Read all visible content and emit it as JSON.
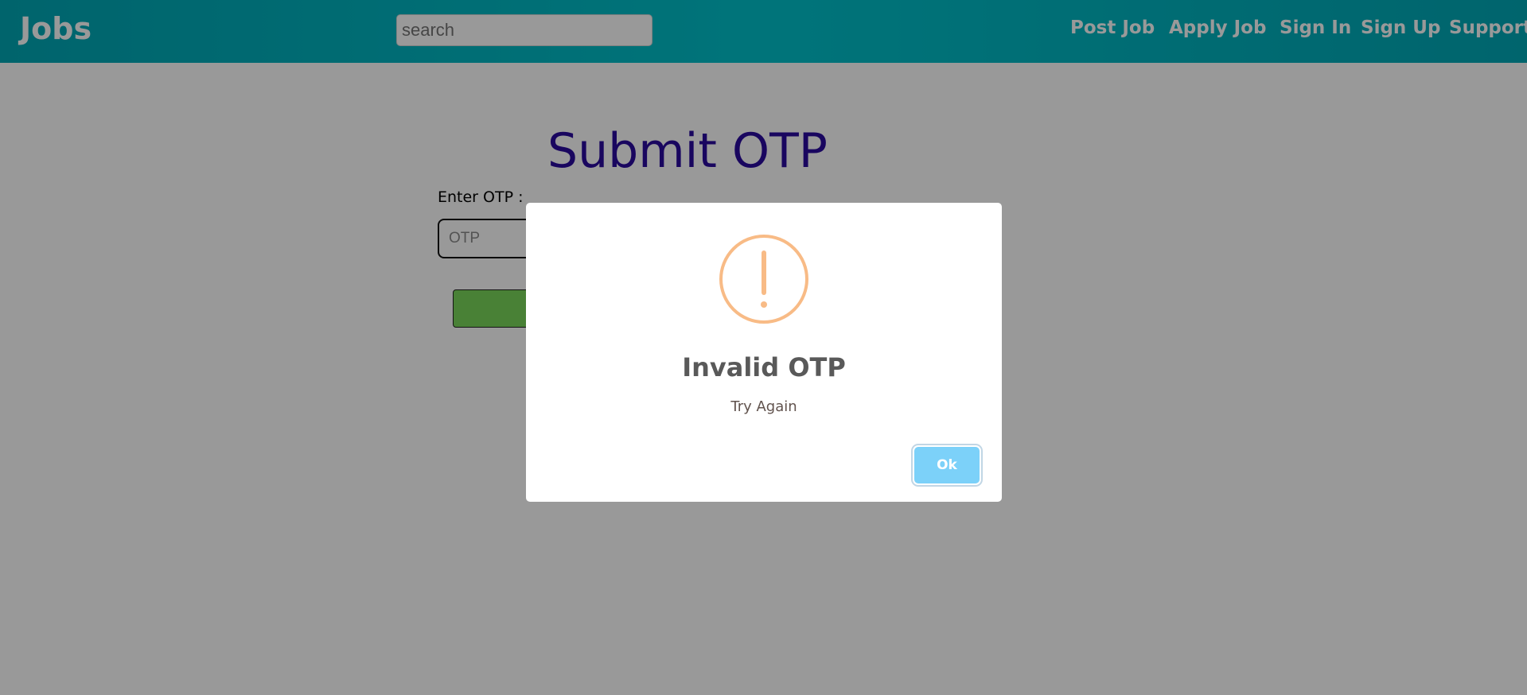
{
  "header": {
    "brand": "Jobs",
    "search": {
      "placeholder": "search",
      "value": ""
    },
    "nav": [
      {
        "label": "Post Job"
      },
      {
        "label": "Apply Job"
      },
      {
        "label": "Sign In"
      },
      {
        "label": "Sign Up"
      },
      {
        "label": "Support"
      }
    ]
  },
  "main": {
    "title": "Submit OTP",
    "otp_label": "Enter OTP :",
    "otp_input": {
      "placeholder": "OTP",
      "value": ""
    },
    "submit_label": ""
  },
  "modal": {
    "icon": "warning-icon",
    "title": "Invalid OTP",
    "text": "Try Again",
    "ok_label": "Ok"
  },
  "colors": {
    "header": "#00b0bc",
    "title": "#2a0a9e",
    "submit_button": "#7bd85a",
    "warning_icon": "#f8bb86",
    "ok_button": "#7cd1f9"
  }
}
